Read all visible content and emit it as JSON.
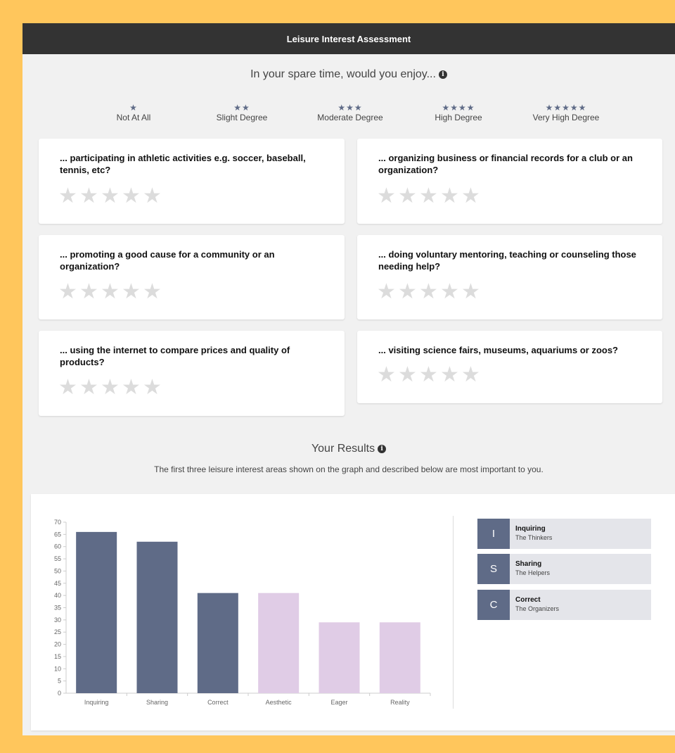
{
  "header": {
    "title": "Leisure Interest Assessment"
  },
  "prompt": {
    "text": "In your spare time, would you enjoy...",
    "info_glyph": "i"
  },
  "scale": [
    {
      "stars": "★",
      "label": "Not At All"
    },
    {
      "stars": "★★",
      "label": "Slight Degree"
    },
    {
      "stars": "★★★",
      "label": "Moderate Degree"
    },
    {
      "stars": "★★★★",
      "label": "High Degree"
    },
    {
      "stars": "★★★★★",
      "label": "Very High Degree"
    }
  ],
  "questions": [
    {
      "text": "... participating in athletic activities e.g. soccer, baseball, tennis, etc?",
      "rating": 0
    },
    {
      "text": "... organizing business or financial records for a club or an organization?",
      "rating": 0
    },
    {
      "text": "... promoting a good cause for a community or an organization?",
      "rating": 0
    },
    {
      "text": "... doing voluntary mentoring, teaching or counseling those needing help?",
      "rating": 0
    },
    {
      "text": "... using the internet to compare prices and quality of products?",
      "rating": 0
    },
    {
      "text": "... visiting science fairs, museums, aquariums or zoos?",
      "rating": 0
    }
  ],
  "star_glyph": "★",
  "results": {
    "title": "Your Results",
    "subtitle": "The first three leisure interest areas shown on the graph and described below are most important to you.",
    "top_three": [
      {
        "letter": "I",
        "name": "Inquiring",
        "desc": "The Thinkers"
      },
      {
        "letter": "S",
        "name": "Sharing",
        "desc": "The Helpers"
      },
      {
        "letter": "C",
        "name": "Correct",
        "desc": "The Organizers"
      }
    ]
  },
  "colors": {
    "primary": "#5f6b87",
    "secondary": "#e0cce6",
    "star_empty": "#dcdcdc",
    "header_bg": "#333333",
    "frame": "#ffc65c"
  },
  "chart_data": {
    "type": "bar",
    "categories": [
      "Inquiring",
      "Sharing",
      "Correct",
      "Aesthetic",
      "Eager",
      "Reality"
    ],
    "values": [
      66,
      62,
      41,
      41,
      29,
      29
    ],
    "highlighted": [
      true,
      true,
      true,
      false,
      false,
      false
    ],
    "ylim": [
      0,
      70
    ],
    "yticks": [
      0,
      5,
      10,
      15,
      20,
      25,
      30,
      35,
      40,
      45,
      50,
      55,
      60,
      65,
      70
    ],
    "grid": false,
    "title": "",
    "xlabel": "",
    "ylabel": ""
  }
}
